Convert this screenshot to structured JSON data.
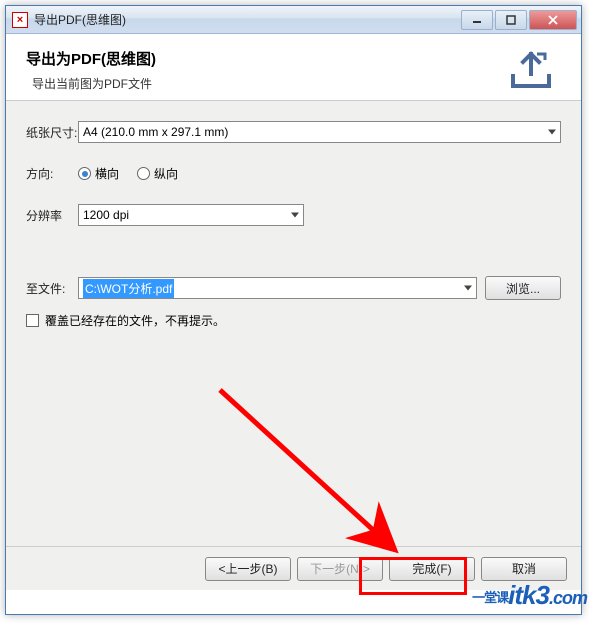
{
  "titlebar": {
    "app_icon_text": "×",
    "title": "导出PDF(思维图)"
  },
  "header": {
    "title": "导出为PDF(思维图)",
    "description": "导出当前图为PDF文件"
  },
  "form": {
    "paper_label": "纸张尺寸:",
    "paper_value": "A4 (210.0 mm x 297.1 mm)",
    "orientation_label": "方向:",
    "orientation_options": {
      "landscape": "横向",
      "portrait": "纵向"
    },
    "orientation_selected": "landscape",
    "dpi_label": "分辨率",
    "dpi_value": "1200 dpi",
    "file_label": "至文件:",
    "file_value": "C:\\WOT分析.pdf",
    "browse_label": "浏览...",
    "overwrite_label": "覆盖已经存在的文件，不再提示。"
  },
  "footer": {
    "back": "<上一步(B)",
    "next": "下一步(N)>",
    "finish": "完成(F)",
    "cancel": "取消"
  },
  "watermark": {
    "prefix": "一堂课",
    "main": "itk3",
    "suffix": ".com"
  }
}
